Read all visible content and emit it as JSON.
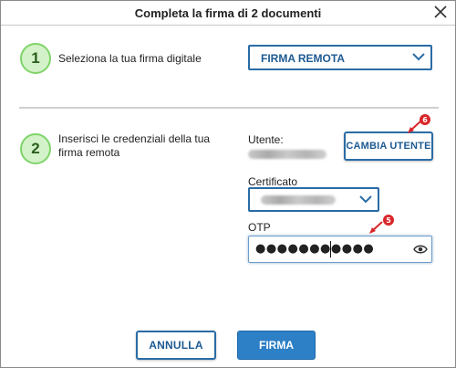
{
  "dialog": {
    "title": "Completa la firma di 2 documenti"
  },
  "step1": {
    "number": "1",
    "text": "Seleziona la tua firma digitale",
    "signature_select": {
      "value": "FIRMA REMOTA"
    }
  },
  "step2": {
    "number": "2",
    "text_line1": "Inserisci le credenziali della tua",
    "text_line2": "firma remota",
    "user_label": "Utente:",
    "change_user_button": "CAMBIA UTENTE",
    "certificate_label": "Certificato",
    "otp_label": "OTP",
    "otp_value": "●●●●●●●●●●●"
  },
  "annotations": {
    "marker_change_user": "6",
    "marker_otp": "5",
    "marker_color": "#d9262a"
  },
  "footer": {
    "cancel_button": "ANNULLA",
    "sign_button": "FIRMA"
  },
  "colors": {
    "accent": "#2a6ca5",
    "primary_button": "#2d7fc6",
    "step_circle_fill": "#d4f2c9",
    "step_circle_border": "#7fd46a"
  }
}
